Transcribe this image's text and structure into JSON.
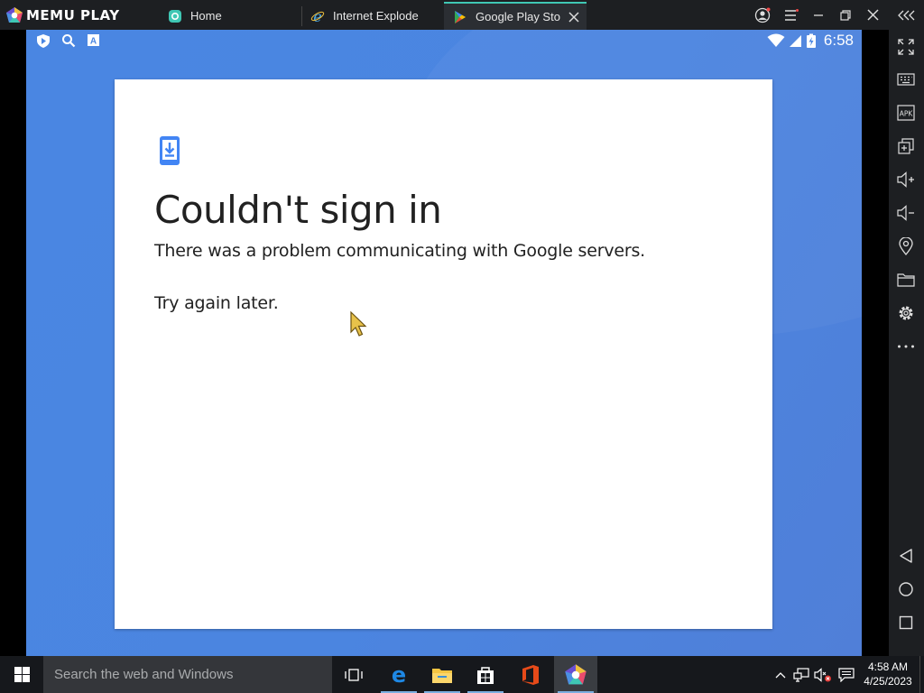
{
  "titlebar": {
    "brand": "MEMU PLAY",
    "tabs": [
      {
        "label": "Home",
        "icon": "memu-home-icon"
      },
      {
        "label": "Internet Explode",
        "icon": "internet-explorer-icon"
      },
      {
        "label": "Google Play Store",
        "icon": "play-store-icon",
        "active": true
      }
    ]
  },
  "status_bar": {
    "time": "6:58"
  },
  "dialog": {
    "icon": "phone-download-icon",
    "title": "Couldn't sign in",
    "message": "There was a problem communicating with Google servers.",
    "retry_message": "Try again later."
  },
  "taskbar": {
    "search_placeholder": "Search the web and Windows",
    "time": "4:58 AM",
    "date": "4/25/2023"
  },
  "colors": {
    "android_background": "#4a86e2",
    "accent_teal": "#3fc7b4",
    "icon_blue": "#4285f4"
  }
}
